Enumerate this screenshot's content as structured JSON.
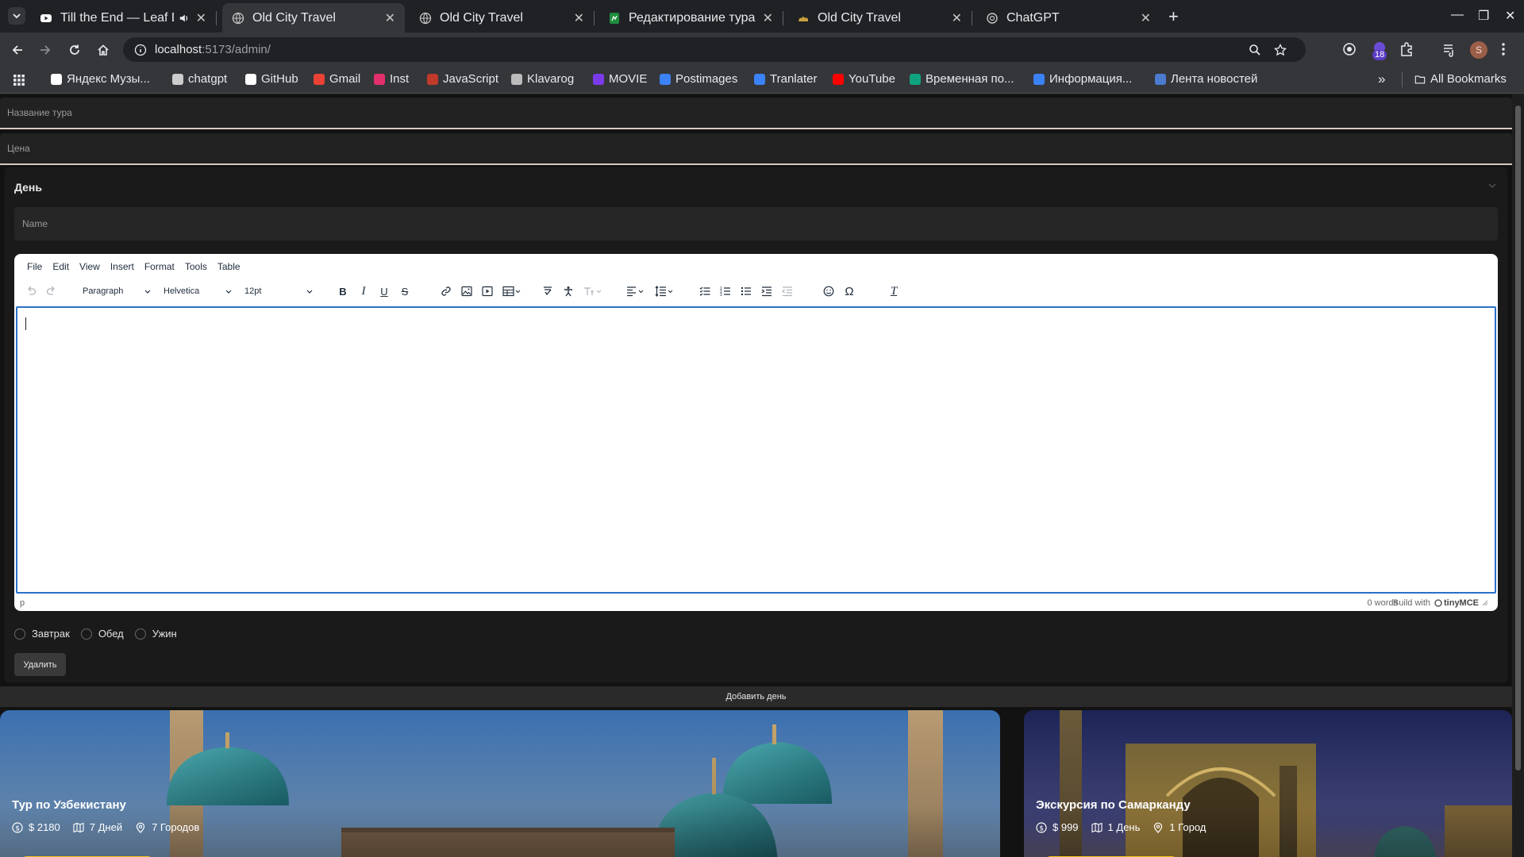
{
  "tabs": [
    {
      "title": "Till the End — Leaf Dr",
      "icon": "youtube-icon",
      "active": false
    },
    {
      "title": "Old City Travel",
      "icon": "globe-icon",
      "active": true
    },
    {
      "title": "Old City Travel",
      "icon": "globe-icon",
      "active": false
    },
    {
      "title": "Редактирование тура: E",
      "icon": "sheet-icon",
      "active": false
    },
    {
      "title": "Old City Travel",
      "icon": "camel-icon",
      "active": false
    },
    {
      "title": "ChatGPT",
      "icon": "chatgpt-icon",
      "active": false
    }
  ],
  "address": {
    "host": "localhost",
    "path": ":5173/admin/"
  },
  "extensions_badge": "18",
  "profile_initial": "S",
  "bookmarks": [
    {
      "label": "Яндекс Музы...",
      "color": "#ffffff"
    },
    {
      "label": "chatgpt",
      "color": "#cccccc"
    },
    {
      "label": "GitHub",
      "color": "#ffffff"
    },
    {
      "label": "Gmail",
      "color": "#ea4335"
    },
    {
      "label": "Inst",
      "color": "#e1306c"
    },
    {
      "label": "JavaScript",
      "color": "#c0392b"
    },
    {
      "label": "Klavarog",
      "color": "#bbbbbb"
    },
    {
      "label": "MOVIE",
      "color": "#7c3aed"
    },
    {
      "label": "Postimages",
      "color": "#3b82f6"
    },
    {
      "label": "Tranlater",
      "color": "#3b82f6"
    },
    {
      "label": "YouTube",
      "color": "#ff0000"
    },
    {
      "label": "Временная по...",
      "color": "#10a37f"
    },
    {
      "label": "Информация...",
      "color": "#3b82f6"
    },
    {
      "label": "Лента новостей",
      "color": "#4a7bd0"
    }
  ],
  "all_bookmarks": "All Bookmarks",
  "form": {
    "tour_name_placeholder": "Название тура",
    "price_placeholder": "Цена",
    "day_title": "День",
    "name_placeholder": "Name"
  },
  "editor": {
    "menu": [
      "File",
      "Edit",
      "View",
      "Insert",
      "Format",
      "Tools",
      "Table"
    ],
    "block_format": "Paragraph",
    "font_family": "Helvetica",
    "font_size": "12pt",
    "status_path": "p",
    "word_count": "0 words",
    "brand": "Build with",
    "brand_name": "tinyMCE"
  },
  "meals": [
    "Завтрак",
    "Обед",
    "Ужин"
  ],
  "delete_label": "Удалить",
  "add_day_label": "Добавить день",
  "cards": [
    {
      "title": "Тур по Узбекистану",
      "price": "$ 2180",
      "days": "7 Дней",
      "cities": "7 Городов"
    },
    {
      "title": "Экскурсия по Самарканду",
      "price": "$ 999",
      "days": "1 День",
      "cities": "1 Город"
    }
  ],
  "colors": {
    "accent": "#2b70c9",
    "cta": "#f5c518",
    "field_underline": "#d9c8c0"
  }
}
